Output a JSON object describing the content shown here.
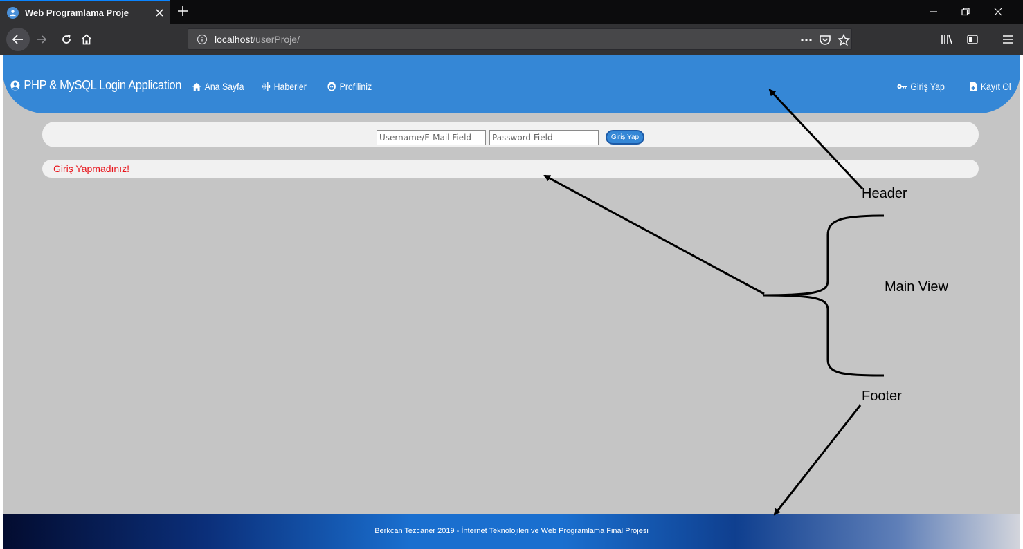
{
  "browser": {
    "tab_title": "Web Programlama Proje",
    "url_host": "localhost",
    "url_path": "/userProje/"
  },
  "header": {
    "brand": "PHP & MySQL Login Application",
    "nav": [
      {
        "label": "Ana Sayfa",
        "icon": "home-icon"
      },
      {
        "label": "Haberler",
        "icon": "pulse-icon"
      },
      {
        "label": "Profiliniz",
        "icon": "face-icon"
      }
    ],
    "right_nav": [
      {
        "label": "Giriş Yap",
        "icon": "key-icon"
      },
      {
        "label": "Kayıt Ol",
        "icon": "file-plus-icon"
      }
    ]
  },
  "login": {
    "username_placeholder": "Username/E-Mail Field",
    "password_placeholder": "Password Field",
    "submit_label": "Giriş Yap"
  },
  "status": {
    "message": "Giriş Yapmadınız!",
    "color": "#e8141b"
  },
  "footer": {
    "text": "Berkcan Tezcaner 2019 - İnternet Teknolojileri ve Web Programlama Final Projesi"
  },
  "annotations": {
    "header": "Header",
    "main_view": "Main View",
    "footer": "Footer"
  },
  "colors": {
    "accent": "#3587d6",
    "page_bg": "#c5c5c5"
  }
}
